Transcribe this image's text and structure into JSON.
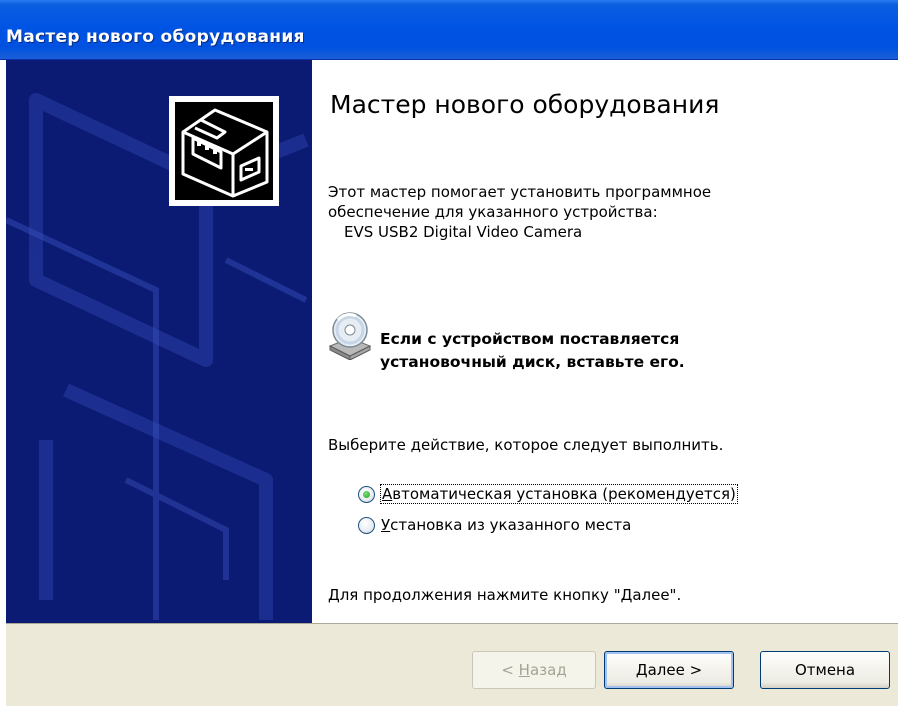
{
  "window": {
    "title": "Мастер нового оборудования"
  },
  "main": {
    "heading": "Мастер нового оборудования",
    "intro_line1": "Этот мастер помогает установить программное",
    "intro_line2": "обеспечение для указанного устройства:",
    "device_name": "EVS USB2 Digital Video Camera",
    "cd_note_line1": "Если с устройством поставляется",
    "cd_note_line2": "установочный диск, вставьте его.",
    "action_prompt": "Выберите действие, которое следует выполнить.",
    "options": [
      {
        "label_accel": "А",
        "label_rest": "втоматическая установка (рекомендуется)",
        "selected": true
      },
      {
        "label_accel": "У",
        "label_rest": "становка из указанного места",
        "selected": false
      }
    ],
    "continue_note": "Для продолжения нажмите кнопку \"Далее\"."
  },
  "buttons": {
    "back_prefix": "< ",
    "back_accel": "Н",
    "back_rest": "азад",
    "next_accel": "Д",
    "next_rest": "алее >",
    "cancel": "Отмена"
  },
  "icons": {
    "side_panel": "hardware-icon",
    "cd": "cd-drive-icon"
  },
  "colors": {
    "titlebar": "#0054e3",
    "side_panel": "#0b1a73",
    "button_bar": "#ece9d8"
  }
}
